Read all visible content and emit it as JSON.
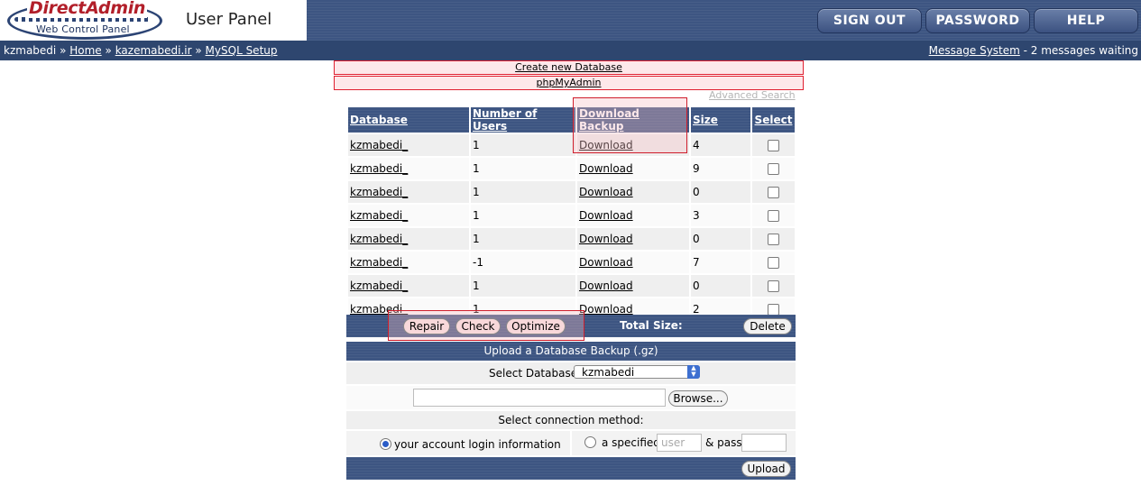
{
  "header": {
    "logo_title": "DirectAdmin",
    "logo_subtitle": "Web Control Panel",
    "panel_title": "User Panel",
    "nav": [
      "SIGN OUT",
      "PASSWORD",
      "HELP"
    ]
  },
  "breadcrumb": {
    "user": "kzmabedi",
    "sep": "»",
    "links": [
      "Home",
      "kazemabedi.ir",
      "MySQL Setup"
    ]
  },
  "messages": {
    "link": "Message System",
    "suffix": " - 2 messages waiting"
  },
  "actions": {
    "create": "Create new Database",
    "phpmyadmin": "phpMyAdmin",
    "advanced_search": "Advanced Search"
  },
  "table": {
    "headers": [
      "Database",
      "Number of Users",
      "Download Backup",
      "Size",
      "Select"
    ],
    "rows": [
      {
        "database": "kzmabedi_",
        "users": "1",
        "download": "Download",
        "size": "4"
      },
      {
        "database": "kzmabedi_",
        "users": "1",
        "download": "Download",
        "size": "9"
      },
      {
        "database": "kzmabedi_",
        "users": "1",
        "download": "Download",
        "size": "0"
      },
      {
        "database": "kzmabedi_",
        "users": "1",
        "download": "Download",
        "size": "3"
      },
      {
        "database": "kzmabedi_",
        "users": "1",
        "download": "Download",
        "size": "0"
      },
      {
        "database": "kzmabedi_",
        "users": "-1",
        "download": "Download",
        "size": "7"
      },
      {
        "database": "kzmabedi_",
        "users": "1",
        "download": "Download",
        "size": "0"
      },
      {
        "database": "kzmabedi_",
        "users": "1",
        "download": "Download",
        "size": "2"
      }
    ]
  },
  "table_actions": {
    "repair": "Repair",
    "check": "Check",
    "optimize": "Optimize",
    "total_size": "Total Size:",
    "delete": "Delete"
  },
  "upload": {
    "title": "Upload a Database Backup (.gz)",
    "select_label": "Select Database",
    "selected_db": "kzmabedi",
    "browse": "Browse...",
    "conn_label": "Select connection method:",
    "opt_account": "your account login information",
    "opt_specified": "a specified",
    "user_placeholder": "user",
    "pass_label": "& pass",
    "upload_button": "Upload"
  }
}
